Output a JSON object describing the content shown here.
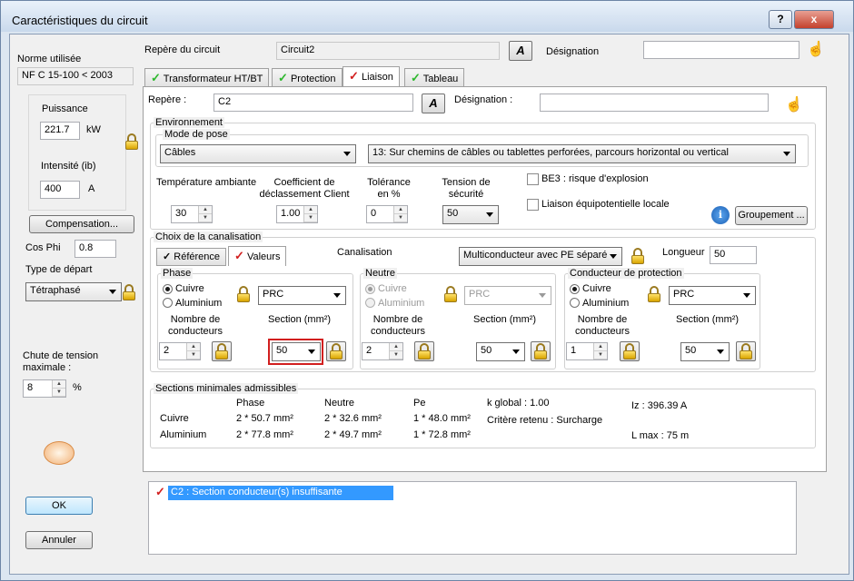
{
  "window": {
    "title": "Caractéristiques du circuit",
    "help": "?",
    "close": "x"
  },
  "left": {
    "norm_label": "Norme utilisée",
    "norm_value": "NF C 15-100 < 2003",
    "power_label": "Puissance",
    "power_value": "221.7",
    "power_unit": "kW",
    "current_label": "Intensité (ib)",
    "current_value": "400",
    "current_unit": "A",
    "compensation_button": "Compensation...",
    "cosphi_label": "Cos Phi",
    "cosphi_value": "0.8",
    "depart_label": "Type de départ",
    "depart_value": "Tétraphasé",
    "chute_label": "Chute de tension maximale :",
    "chute_value": "8",
    "chute_unit": "%",
    "ok_button": "OK",
    "cancel_button": "Annuler"
  },
  "header": {
    "repere_label": "Repère du circuit",
    "repere_value": "Circuit2",
    "designation_label": "Désignation",
    "designation_value": ""
  },
  "tabs": [
    {
      "label": "Transformateur HT/BT",
      "checked": true
    },
    {
      "label": "Protection",
      "checked": true
    },
    {
      "label": "Liaison",
      "checked": false,
      "selected": true
    },
    {
      "label": "Tableau",
      "checked": true
    }
  ],
  "liaison": {
    "repere_label": "Repère :",
    "repere_value": "C2",
    "designation_label": "Désignation :",
    "designation_value": "",
    "env_legend": "Environnement",
    "mode_legend": "Mode de pose",
    "mode_value": "Câbles",
    "mode_detail": "13: Sur chemins de câbles ou tablettes perforées, parcours horizontal ou vertical",
    "temp_label": "Température ambiante",
    "temp_value": "30",
    "coef_label": "Coefficient de déclassement Client",
    "coef_value": "1.00",
    "tol_label": "Tolérance en %",
    "tol_value": "0",
    "tension_label": "Tension de sécurité",
    "tension_value": "50",
    "be3_label": "BE3 : risque d'explosion",
    "equi_label": "Liaison équipotentielle locale",
    "groupement_button": "Groupement ..."
  },
  "canal": {
    "legend": "Choix de la canalisation",
    "tab_reference": "Référence",
    "tab_valeurs": "Valeurs",
    "canal_label": "Canalisation",
    "canal_value": "Multiconducteur avec PE séparé",
    "longueur_label": "Longueur",
    "longueur_value": "50",
    "nb_label": "Nombre de conducteurs",
    "section_label": "Section (mm²)",
    "groups": [
      {
        "legend": "Phase",
        "cuivre": "Cuivre",
        "alu": "Aluminium",
        "iso": "PRC",
        "nb": "2",
        "section": "50",
        "disabled": false
      },
      {
        "legend": "Neutre",
        "cuivre": "Cuivre",
        "alu": "Aluminium",
        "iso": "PRC",
        "nb": "2",
        "section": "50",
        "disabled": true
      },
      {
        "legend": "Conducteur de protection",
        "cuivre": "Cuivre",
        "alu": "Aluminium",
        "iso": "PRC",
        "nb": "1",
        "section": "50",
        "disabled": false
      }
    ]
  },
  "sections": {
    "legend": "Sections minimales admissibles",
    "col_phase": "Phase",
    "col_neutre": "Neutre",
    "col_pe": "Pe",
    "row_cuivre": "Cuivre",
    "row_alu": "Aluminium",
    "cu_phase": "2 * 50.7 mm²",
    "cu_neutre": "2 * 32.6 mm²",
    "cu_pe": "1 * 48.0 mm²",
    "al_phase": "2 * 77.8 mm²",
    "al_neutre": "2 * 49.7 mm²",
    "al_pe": "1 * 72.8 mm²",
    "kglobal": "k global : 1.00",
    "critere": "Critère retenu : Surcharge",
    "iz": "Iz : 396.39 A",
    "lmax": "L max : 75 m"
  },
  "messages": [
    {
      "text": "C2 : Section conducteur(s) insuffisante"
    }
  ],
  "colors": {
    "accent": "#3399ff",
    "error": "#d21f1f",
    "ok": "#2db82d"
  }
}
